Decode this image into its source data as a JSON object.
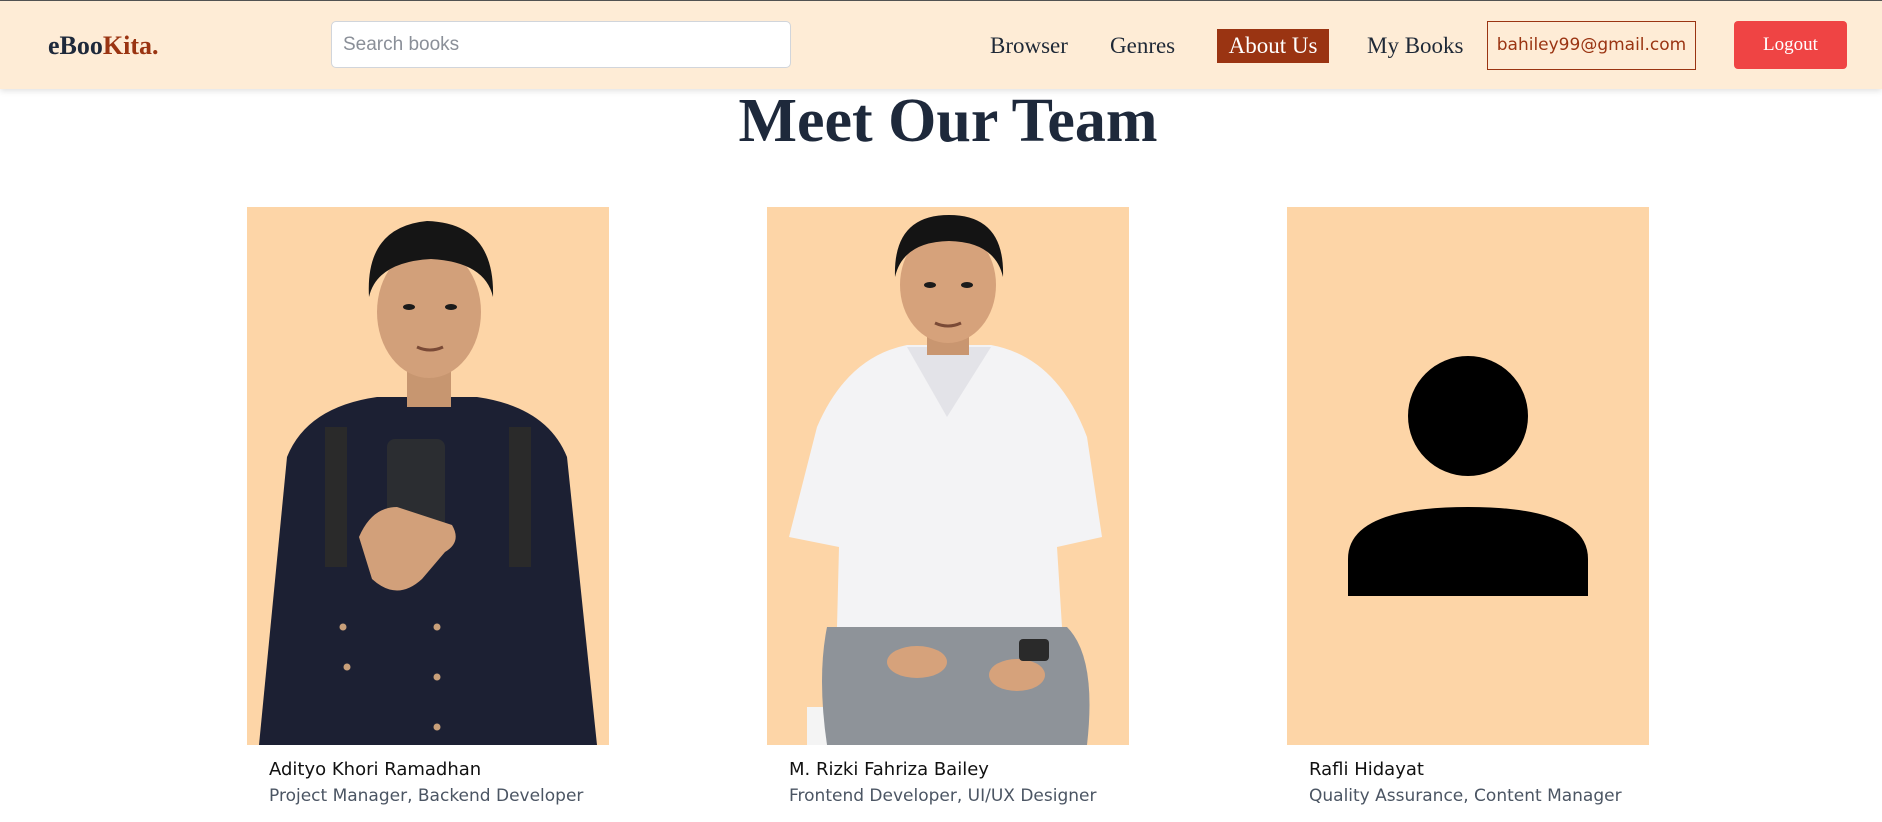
{
  "header": {
    "logo_main": "eBoo",
    "logo_accent": "Kita.",
    "search_placeholder": "Search books",
    "nav": {
      "browser": "Browser",
      "genres": "Genres",
      "about": "About Us",
      "mybooks": "My Books"
    },
    "email": "bahiley99@gmail.com",
    "logout": "Logout"
  },
  "page": {
    "title": "Meet Our Team"
  },
  "team": [
    {
      "name": "Adityo Khori Ramadhan",
      "role": "Project Manager, Backend Developer"
    },
    {
      "name": "M. Rizki Fahriza Bailey",
      "role": "Frontend Developer, UI/UX Designer"
    },
    {
      "name": "Rafli Hidayat",
      "role": "Quality Assurance, Content Manager"
    }
  ],
  "colors": {
    "navbar_bg": "#feecd6",
    "accent": "#9a3412",
    "photo_bg": "#fdd5a7",
    "logout_bg": "#ef4444"
  }
}
